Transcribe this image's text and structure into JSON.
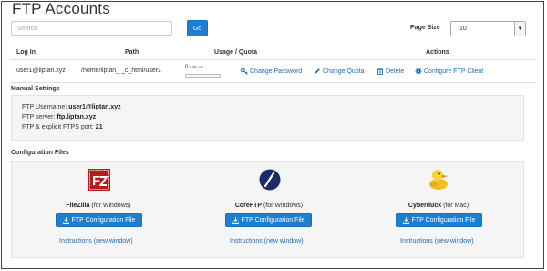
{
  "page": {
    "title": "FTP Accounts"
  },
  "search": {
    "placeholder": "Search",
    "go_label": "Go"
  },
  "page_size": {
    "label": "Page Size",
    "value": "10"
  },
  "table": {
    "headers": {
      "login": "Log In",
      "path": "Path",
      "usage": "Usage  /  Quota",
      "actions": "Actions"
    },
    "row": {
      "login": "user1@liptan.xyz",
      "path": "/home/liptan_ _c_html/user1",
      "usage": "0 / ∞",
      "usage_unit": "MB",
      "usage_fraction": 0
    },
    "actions": {
      "change_password": "Change Password",
      "change_quota": "Change Quota",
      "delete": "Delete",
      "configure": "Configure FTP Client"
    }
  },
  "manual": {
    "title": "Manual Settings",
    "username_label": "FTP Username:",
    "username": "user1@liptan.xyz",
    "server_label": "FTP server:",
    "server": "ftp.liptan.xyz",
    "port_label": "FTP & explicit FTPS port:",
    "port": "21"
  },
  "config": {
    "title": "Configuration Files",
    "clients": [
      {
        "name": "FileZilla",
        "platform": "(for Windows)",
        "button": "FTP Configuration File",
        "link": "Instructions (new window)",
        "icon": "filezilla-logo"
      },
      {
        "name": "CoreFTP",
        "platform": "(for Windows)",
        "button": "FTP Configuration File",
        "link": "Instructions (new window)",
        "icon": "coreftp-logo"
      },
      {
        "name": "Cyberduck",
        "platform": "(for Mac)",
        "button": "FTP Configuration File",
        "link": "Instructions (new window)",
        "icon": "cyberduck-logo"
      }
    ]
  },
  "colors": {
    "primary": "#1e7fd0",
    "link": "#1e6bb8",
    "filezilla": "#b31d1d",
    "coreftp": "#1d2a6b"
  }
}
